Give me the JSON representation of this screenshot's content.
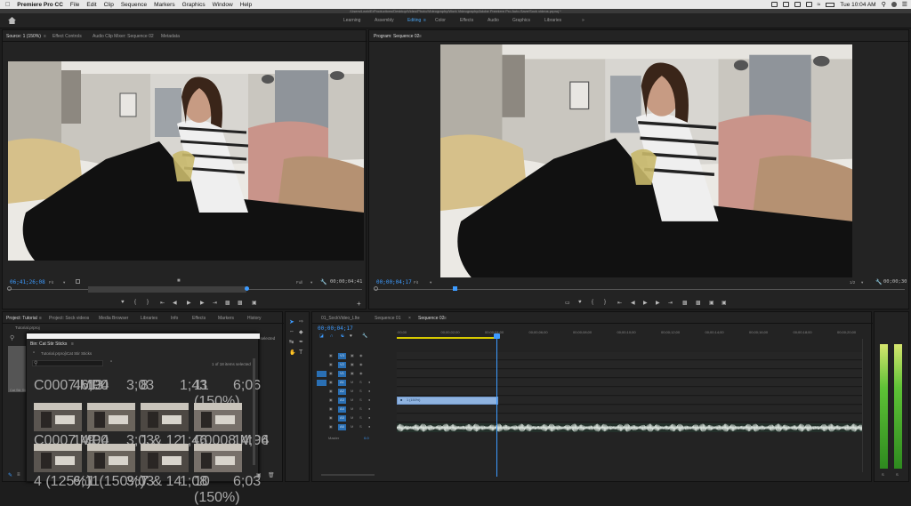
{
  "menubar": {
    "app_name": "Premiere Pro CC",
    "items": [
      "File",
      "Edit",
      "Clip",
      "Sequence",
      "Markers",
      "Graphics",
      "Window",
      "Help"
    ],
    "clock": "Tue 10:04 AM"
  },
  "titlebar": {
    "path": "/Users/Leah/ErProductions/Desktop/Video/Photo/Videography/Work Videography/Adobe Premiere Pro Auto-Save/Sock videos.prproj *"
  },
  "workspaces": {
    "items": [
      "Learning",
      "Assembly",
      "Editing",
      "Color",
      "Effects",
      "Audio",
      "Graphics",
      "Libraries"
    ],
    "active": "Editing",
    "more": "»"
  },
  "source": {
    "tabs": [
      "Source: 1 (150%)",
      "Effect Controls",
      "Audio Clip Mixer: Sequence 02",
      "Metadata"
    ],
    "timecode": "06;41;26;08",
    "zoom": "Fit",
    "quality": "Full",
    "duration": "00;00;04;41"
  },
  "program": {
    "tab": "Program: Sequence 02",
    "timecode": "00;00;04;17",
    "zoom": "Fit",
    "fraction": "1/2",
    "duration": "00;00;30"
  },
  "project": {
    "tabs": [
      "Project: Tutorial",
      "Project: Sock videos",
      "Media Browser",
      "Libraries",
      "Info",
      "Effects",
      "Markers",
      "History"
    ],
    "project_file": "Tutorial.prproj",
    "bin_title": "Bin: Cat Stir Sticks",
    "bin_path": "Tutorial.prproj\\Cat Stir Sticks",
    "items_count": "1 of 18 items selected",
    "selected_note": "is selected",
    "bin_side_label": "Cat Stir Sticks",
    "row0": [
      {
        "name": "C0007.MP4",
        "dur": "46;00"
      },
      {
        "name": "13",
        "dur": "3;03"
      },
      {
        "name": "8",
        "dur": "1;43"
      },
      {
        "name": "11 (150%)",
        "dur": "6;06"
      }
    ],
    "row1": [
      {
        "name": "C0007.MP4",
        "dur": "14;00"
      },
      {
        "name": "9",
        "dur": "3;03"
      },
      {
        "name": "1 & 12",
        "dur": "1;46"
      },
      {
        "name": "C0008.MP4",
        "dur": "14;06"
      }
    ],
    "row2": [
      {
        "name": "4 (125%)",
        "dur": "6;11"
      },
      {
        "name": "1 (150%)",
        "dur": "3;03"
      },
      {
        "name": "7 & 14",
        "dur": "1;08"
      },
      {
        "name": "10 (150%)",
        "dur": "6;03"
      }
    ]
  },
  "timeline": {
    "tabs": [
      "01_SockVideo_LIte",
      "Sequence 01",
      "Sequence 02"
    ],
    "active_tab": "Sequence 02",
    "timecode": "00;00;04;17",
    "ticks": [
      ":00;00",
      "00;00;02;00",
      "00;00;04;00",
      "00;00;06;00",
      "00;00;08;00",
      "00;00;10;00",
      "00;00;12;00",
      "00;00;14;00",
      "00;00;16;00",
      "00;00;18;00",
      "00;00;20;00"
    ],
    "video_tracks": [
      "V3",
      "V2",
      "V1"
    ],
    "audio_tracks": [
      "A1",
      "A2",
      "A3",
      "A4",
      "A5",
      "A6"
    ],
    "clip_name": "1 (150%)",
    "master_label": "Master",
    "master_value": "0.0"
  },
  "meters": {
    "labels": [
      "S",
      "S"
    ]
  },
  "colors": {
    "accent": "#3d9bff",
    "clip_video": "#8fb3e0",
    "playhead": "#3d9bff"
  }
}
